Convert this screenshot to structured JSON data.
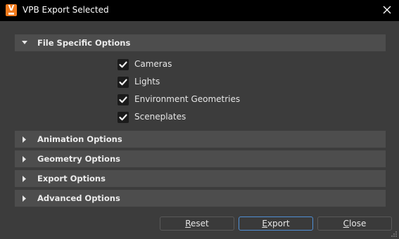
{
  "window": {
    "title": "VPB Export Selected",
    "app_icon": "vred-v-icon",
    "app_icon_letter": "V"
  },
  "sections": [
    {
      "label": "File Specific Options",
      "expanded": true,
      "options": [
        {
          "label": "Cameras",
          "checked": true
        },
        {
          "label": "Lights",
          "checked": true
        },
        {
          "label": "Environment Geometries",
          "checked": true
        },
        {
          "label": "Sceneplates",
          "checked": true
        }
      ]
    },
    {
      "label": "Animation Options",
      "expanded": false
    },
    {
      "label": "Geometry Options",
      "expanded": false
    },
    {
      "label": "Export Options",
      "expanded": false
    },
    {
      "label": "Advanced Options",
      "expanded": false
    }
  ],
  "buttons": {
    "reset": {
      "first": "R",
      "rest": "eset"
    },
    "export": {
      "first": "E",
      "rest": "xport"
    },
    "close": {
      "first": "C",
      "rest": "lose"
    }
  },
  "colors": {
    "accent_orange": "#f07a1c",
    "focus_blue": "#4f8fd6",
    "window_bg": "#3c3c3c",
    "section_bg": "#4d4d4d"
  }
}
